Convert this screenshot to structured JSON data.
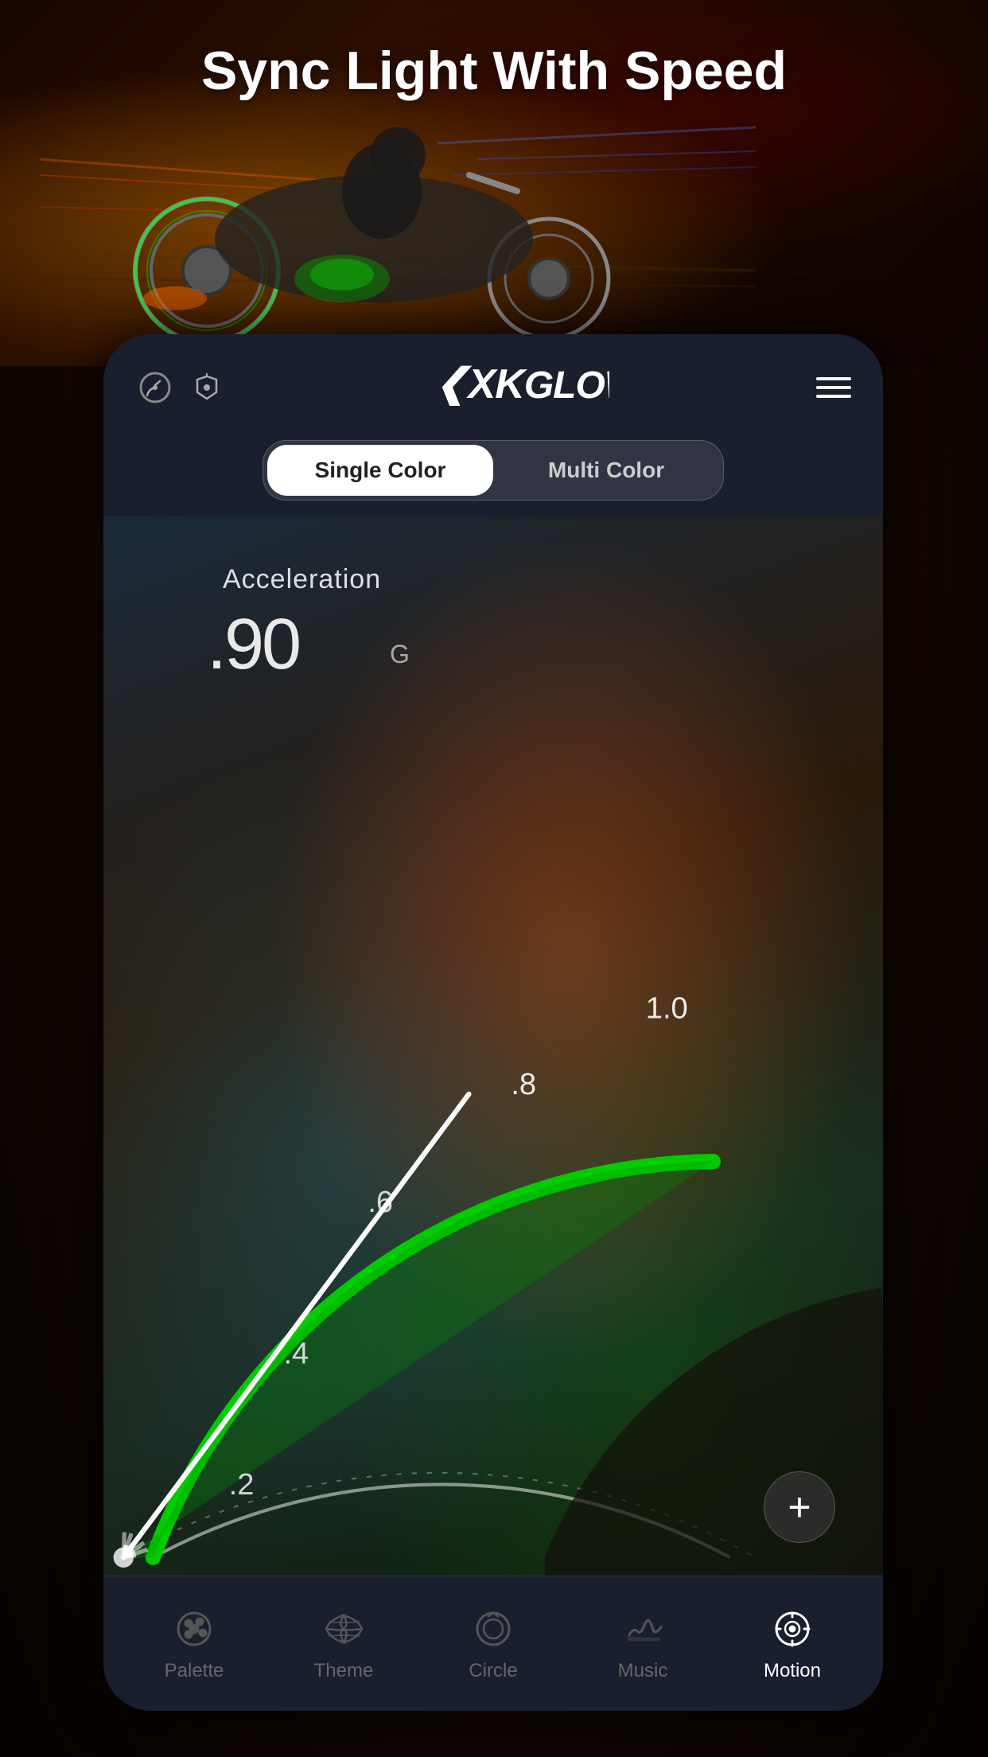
{
  "hero": {
    "title": "Sync Light With Speed"
  },
  "app": {
    "logo": "XKGLOW",
    "logo_prefix": "XK",
    "logo_suffix": "GLOW"
  },
  "tabs": {
    "single_color": "Single Color",
    "multi_color": "Multi Color",
    "active": "single"
  },
  "gauge": {
    "label": "Acceleration",
    "value": ".90",
    "unit": "G",
    "markers": [
      "",
      ".2",
      ".4",
      ".6",
      ".8",
      "1.0"
    ]
  },
  "bottom_nav": {
    "items": [
      {
        "id": "palette",
        "label": "Palette",
        "active": false
      },
      {
        "id": "theme",
        "label": "Theme",
        "active": false
      },
      {
        "id": "circle",
        "label": "Circle",
        "active": false
      },
      {
        "id": "music",
        "label": "Music",
        "active": false
      },
      {
        "id": "motion",
        "label": "Motion",
        "active": true
      }
    ]
  },
  "plus_button": "+"
}
